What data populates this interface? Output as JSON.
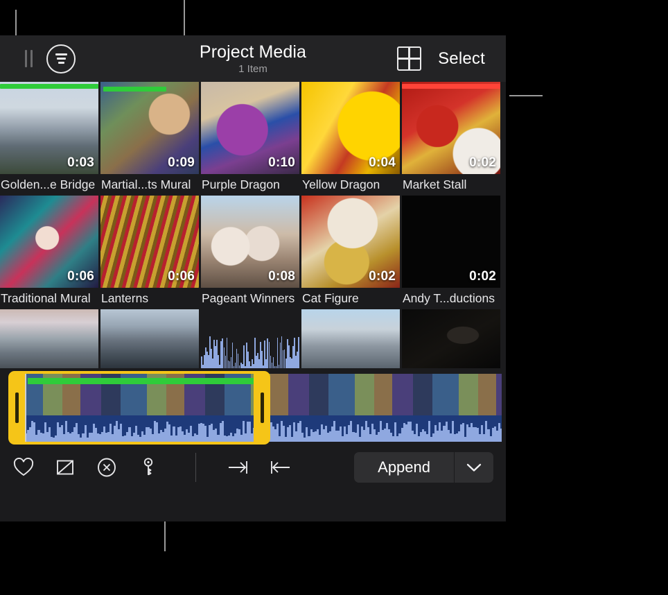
{
  "header": {
    "title": "Project Media",
    "subtitle": "1 Item",
    "grip_icon": "drag-handle-icon",
    "filter_icon": "filter-sort-icon",
    "grid_icon": "grid-view-icon",
    "select_label": "Select"
  },
  "colors": {
    "selection": "#f5c518",
    "used_green": "#2fcc3a",
    "used_red": "#ff4438",
    "panel_bg": "#1b1b1d",
    "header_bg": "#232325",
    "audio_blue": "#1e3a7a",
    "waveform": "#8fa8e0",
    "callout": "#9a9a9a"
  },
  "browser": {
    "rows": [
      [
        {
          "name": "Golden...e Bridge",
          "duration": "0:03",
          "used": "green",
          "used_pct": 100,
          "selected": false,
          "art": "golden-gate-couple"
        },
        {
          "name": "Martial...ts Mural",
          "duration": "0:09",
          "used": "green",
          "used_pct": 70,
          "selected": true,
          "art": "martial-arts-mural"
        },
        {
          "name": "Purple Dragon",
          "duration": "0:10",
          "used": "none",
          "used_pct": 0,
          "selected": false,
          "art": "purple-dragon"
        },
        {
          "name": "Yellow Dragon",
          "duration": "0:04",
          "used": "none",
          "used_pct": 0,
          "selected": false,
          "art": "yellow-dragon"
        },
        {
          "name": "Market Stall",
          "duration": "0:02",
          "used": "red",
          "used_pct": 100,
          "selected": false,
          "art": "market-stall"
        }
      ],
      [
        {
          "name": "Traditional Mural",
          "duration": "0:06",
          "used": "none",
          "used_pct": 0,
          "selected": false,
          "art": "traditional-mural"
        },
        {
          "name": "Lanterns",
          "duration": "0:06",
          "used": "none",
          "used_pct": 0,
          "selected": false,
          "art": "lanterns"
        },
        {
          "name": "Pageant Winners",
          "duration": "0:08",
          "used": "none",
          "used_pct": 0,
          "selected": false,
          "art": "pageant-winners"
        },
        {
          "name": "Cat Figure",
          "duration": "0:02",
          "used": "none",
          "used_pct": 0,
          "selected": false,
          "art": "cat-figure"
        },
        {
          "name": "Andy T...ductions",
          "duration": "0:02",
          "used": "none",
          "used_pct": 0,
          "selected": false,
          "art": "title-card-black"
        }
      ]
    ],
    "partial_row": [
      {
        "art": "golden-gate-fog"
      },
      {
        "art": "bay-bridge-aerial"
      },
      {
        "art": "audio-waveform-clip"
      },
      {
        "art": "city-hall"
      },
      {
        "art": "dark-interior"
      }
    ]
  },
  "filmstrip": {
    "art": "martial-arts-mural-strip",
    "selection_label": "range-selection",
    "handle_left": "trim-handle-left",
    "handle_right": "trim-handle-right",
    "playhead": "playhead"
  },
  "toolbar": {
    "favorite_icon": "heart-icon",
    "unrate_icon": "unrate-slash-icon",
    "reject_icon": "reject-circle-x-icon",
    "keyword_icon": "keyword-key-icon",
    "set_end_icon": "set-range-end-icon",
    "set_start_icon": "set-range-start-icon",
    "append_label": "Append",
    "append_menu_icon": "chevron-down-icon"
  }
}
